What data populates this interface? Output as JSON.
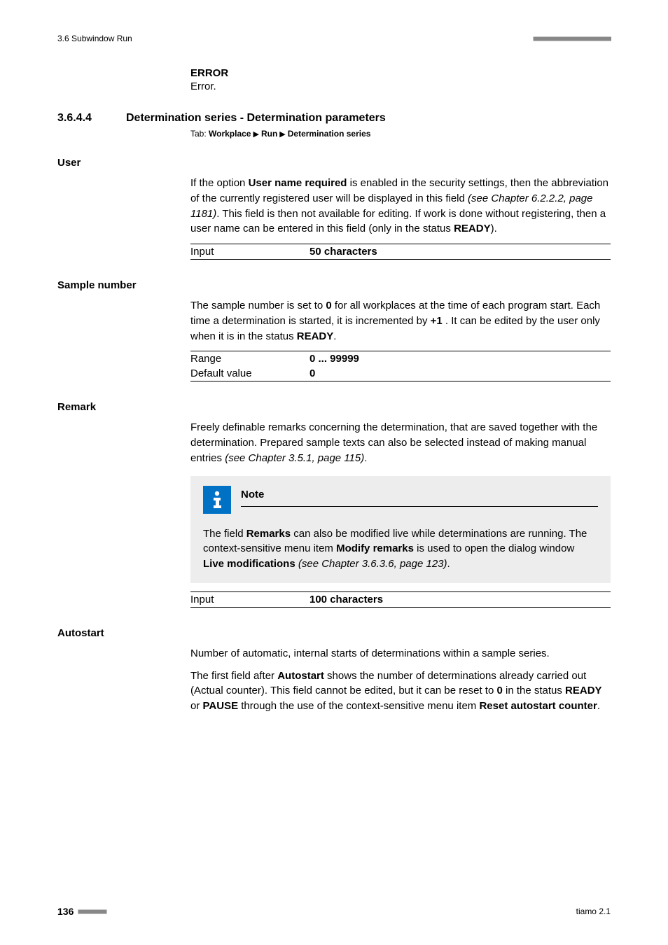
{
  "header": {
    "section_ref": "3.6 Subwindow Run"
  },
  "error": {
    "title": "ERROR",
    "desc": "Error."
  },
  "section": {
    "number": "3.6.4.4",
    "title": "Determination series - Determination parameters",
    "tab_prefix": "Tab: ",
    "tab_path": [
      "Workplace",
      "Run",
      "Determination series"
    ]
  },
  "user": {
    "label": "User",
    "para_1a": "If the option ",
    "para_1b": "User name required",
    "para_1c": " is enabled in the security settings, then the abbreviation of the currently registered user will be displayed in this field ",
    "para_1d": "(see Chapter 6.2.2.2, page 1181)",
    "para_1e": ". This field is then not available for editing. If work is done without registering, then a user name can be entered in this field (only in the status ",
    "para_1f": "READY",
    "para_1g": ").",
    "input_label": "Input",
    "input_value": "50 characters"
  },
  "sample": {
    "label": "Sample number",
    "para_1a": "The sample number is set to ",
    "para_1b": "0",
    "para_1c": " for all workplaces at the time of each program start. Each time a determination is started, it is incremented by ",
    "para_1d": "+1",
    "para_1e": " . It can be edited by the user only when it is in the status ",
    "para_1f": "READY",
    "para_1g": ".",
    "range_label": "Range",
    "range_value": "0 ... 99999",
    "default_label": "Default value",
    "default_value": "0"
  },
  "remark": {
    "label": "Remark",
    "para_1a": "Freely definable remarks concerning the determination, that are saved together with the determination. Prepared sample texts can also be selected instead of making manual entries ",
    "para_1b": "(see Chapter 3.5.1, page 115)",
    "para_1c": ".",
    "note_title": "Note",
    "note_1a": "The field ",
    "note_1b": "Remarks",
    "note_1c": " can also be modified live while determinations are running. The context-sensitive menu item ",
    "note_1d": "Modify remarks",
    "note_1e": " is used to open the dialog window ",
    "note_1f": "Live modifications",
    "note_1g": " ",
    "note_1h": "(see Chapter 3.6.3.6, page 123)",
    "note_1i": ".",
    "input_label": "Input",
    "input_value": "100 characters"
  },
  "autostart": {
    "label": "Autostart",
    "para_1": "Number of automatic, internal starts of determinations within a sample series.",
    "para_2a": "The first field after ",
    "para_2b": "Autostart",
    "para_2c": " shows the number of determinations already carried out (Actual counter). This field cannot be edited, but it can be reset to ",
    "para_2d": "0",
    "para_2e": " in the status ",
    "para_2f": "READY",
    "para_2g": " or ",
    "para_2h": "PAUSE",
    "para_2i": " through the use of the context-sensitive menu item ",
    "para_2j": "Reset autostart counter",
    "para_2k": "."
  },
  "footer": {
    "page": "136",
    "product": "tiamo 2.1"
  }
}
